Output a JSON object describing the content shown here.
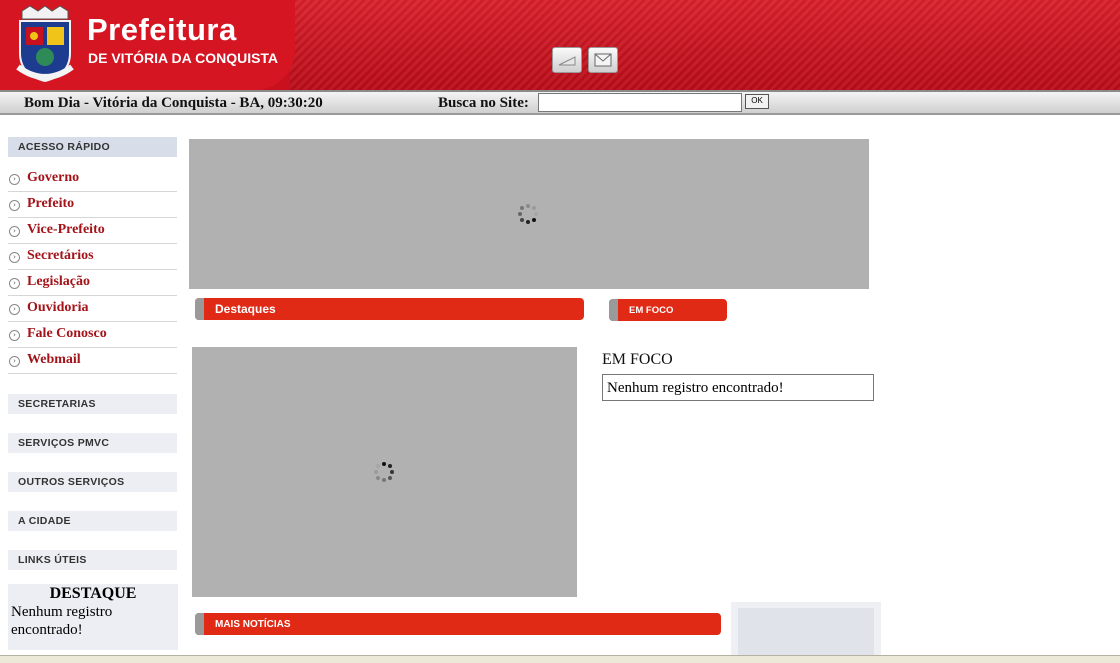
{
  "header": {
    "title": "Prefeitura",
    "subtitle": "DE VITÓRIA DA CONQUISTA",
    "crest_icon": "city-crest-icon",
    "buttons": [
      {
        "icon": "home-icon"
      },
      {
        "icon": "mail-icon"
      }
    ]
  },
  "greeting": "Bom Dia - Vitória da Conquista - BA, 09:30:20",
  "search": {
    "label": "Busca no Site:",
    "value": "",
    "button_label": "OK"
  },
  "sidebar": {
    "quick_access_title": "ACESSO RÁPIDO",
    "items": [
      {
        "label": "Governo"
      },
      {
        "label": "Prefeito"
      },
      {
        "label": "Vice-Prefeito"
      },
      {
        "label": "Secretários"
      },
      {
        "label": "Legislação"
      },
      {
        "label": "Ouvidoria"
      },
      {
        "label": "Fale Conosco"
      },
      {
        "label": "Webmail"
      }
    ],
    "sections": [
      {
        "label": "SECRETARIAS"
      },
      {
        "label": "SERVIÇOS PMVC"
      },
      {
        "label": "OUTROS SERVIÇOS"
      },
      {
        "label": "A CIDADE"
      },
      {
        "label": "LINKS ÚTEIS"
      }
    ],
    "destaque": {
      "title": "DESTAQUE",
      "message": "Nenhum registro encontrado!"
    }
  },
  "main": {
    "destaques_label": "Destaques",
    "em_foco_tab": "EM FOCO",
    "em_foco_title": "EM FOCO",
    "em_foco_message": "Nenhum registro encontrado!",
    "mais_noticias_label": "MAIS NOTÍCIAS"
  },
  "colors": {
    "brand_red": "#c8101e",
    "bar_red": "#e02a16",
    "link_red": "#a3141a"
  }
}
